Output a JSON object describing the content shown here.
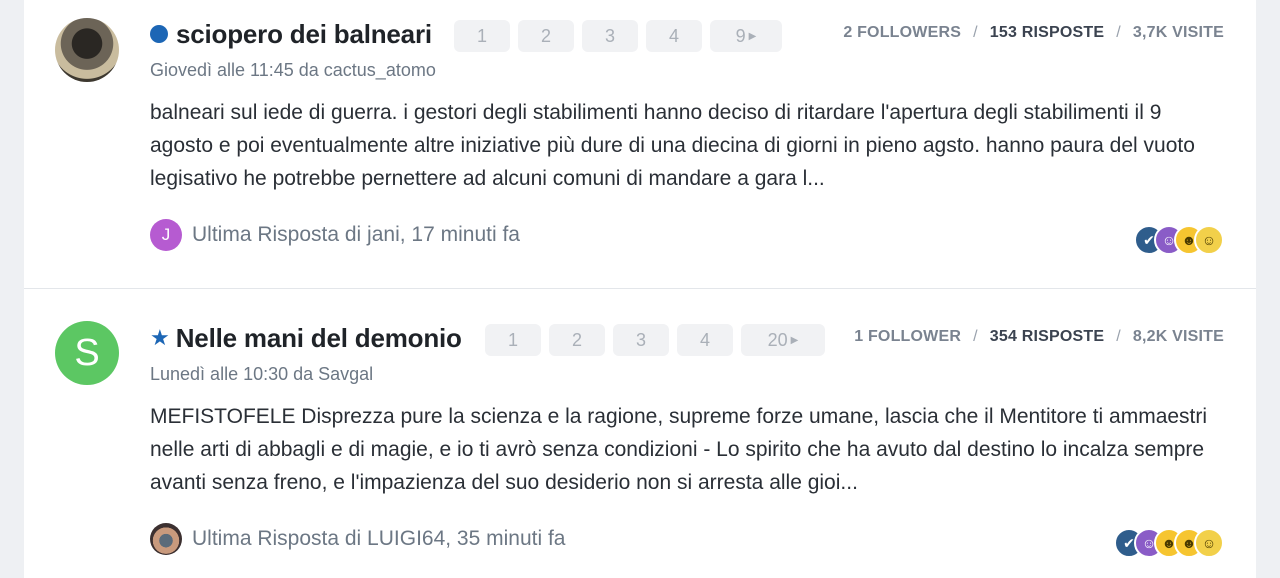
{
  "topics": [
    {
      "title": "sciopero dei balneari",
      "status_icon": "dot-icon",
      "pages": [
        "1",
        "2",
        "3",
        "4",
        "9"
      ],
      "followers": "2 FOLLOWERS",
      "replies": "153 RISPOSTE",
      "views": "3,7K VISITE",
      "meta": "Giovedì alle 11:45 da cactus_atomo",
      "excerpt": "balneari sul iede di guerra. i gestori degli stabilimenti hanno deciso di ritardare l'apertura degli stabilimenti il 9 agosto e poi eventualmente altre iniziative più dure di una diecina di giorni in pieno agsto. hanno paura del vuoto legisativo he potrebbe pernettere ad alcuni comuni di mandare a gara l...",
      "last_reply": "Ultima Risposta di jani, 17 minuti fa",
      "last_reply_avatar": "J",
      "reactions": [
        "reaction-blue-icon",
        "reaction-purple-icon",
        "reaction-laugh-icon",
        "reaction-grin-icon"
      ]
    },
    {
      "title": "Nelle mani del demonio",
      "status_icon": "star-icon",
      "pages": [
        "1",
        "2",
        "3",
        "4",
        "20"
      ],
      "followers": "1 FOLLOWER",
      "replies": "354 RISPOSTE",
      "views": "8,2K VISITE",
      "avatar_letter": "S",
      "meta": "Lunedì alle 10:30 da Savgal",
      "excerpt": "MEFISTOFELE Disprezza pure la scienza e la ragione, supreme forze umane, lascia che il Mentitore ti ammaestri nelle arti di abbagli e di magie, e io ti avrò senza condizioni - Lo spirito che ha avuto dal destino lo incalza sempre avanti senza freno, e l'impazienza del suo desiderio non si arresta alle gioi...",
      "last_reply": "Ultima Risposta di LUIGI64, 35 minuti fa",
      "reactions": [
        "reaction-blue-icon",
        "reaction-purple-icon",
        "reaction-laugh-icon",
        "reaction-tongue-icon",
        "reaction-grin-icon"
      ]
    }
  ],
  "separator": "/"
}
